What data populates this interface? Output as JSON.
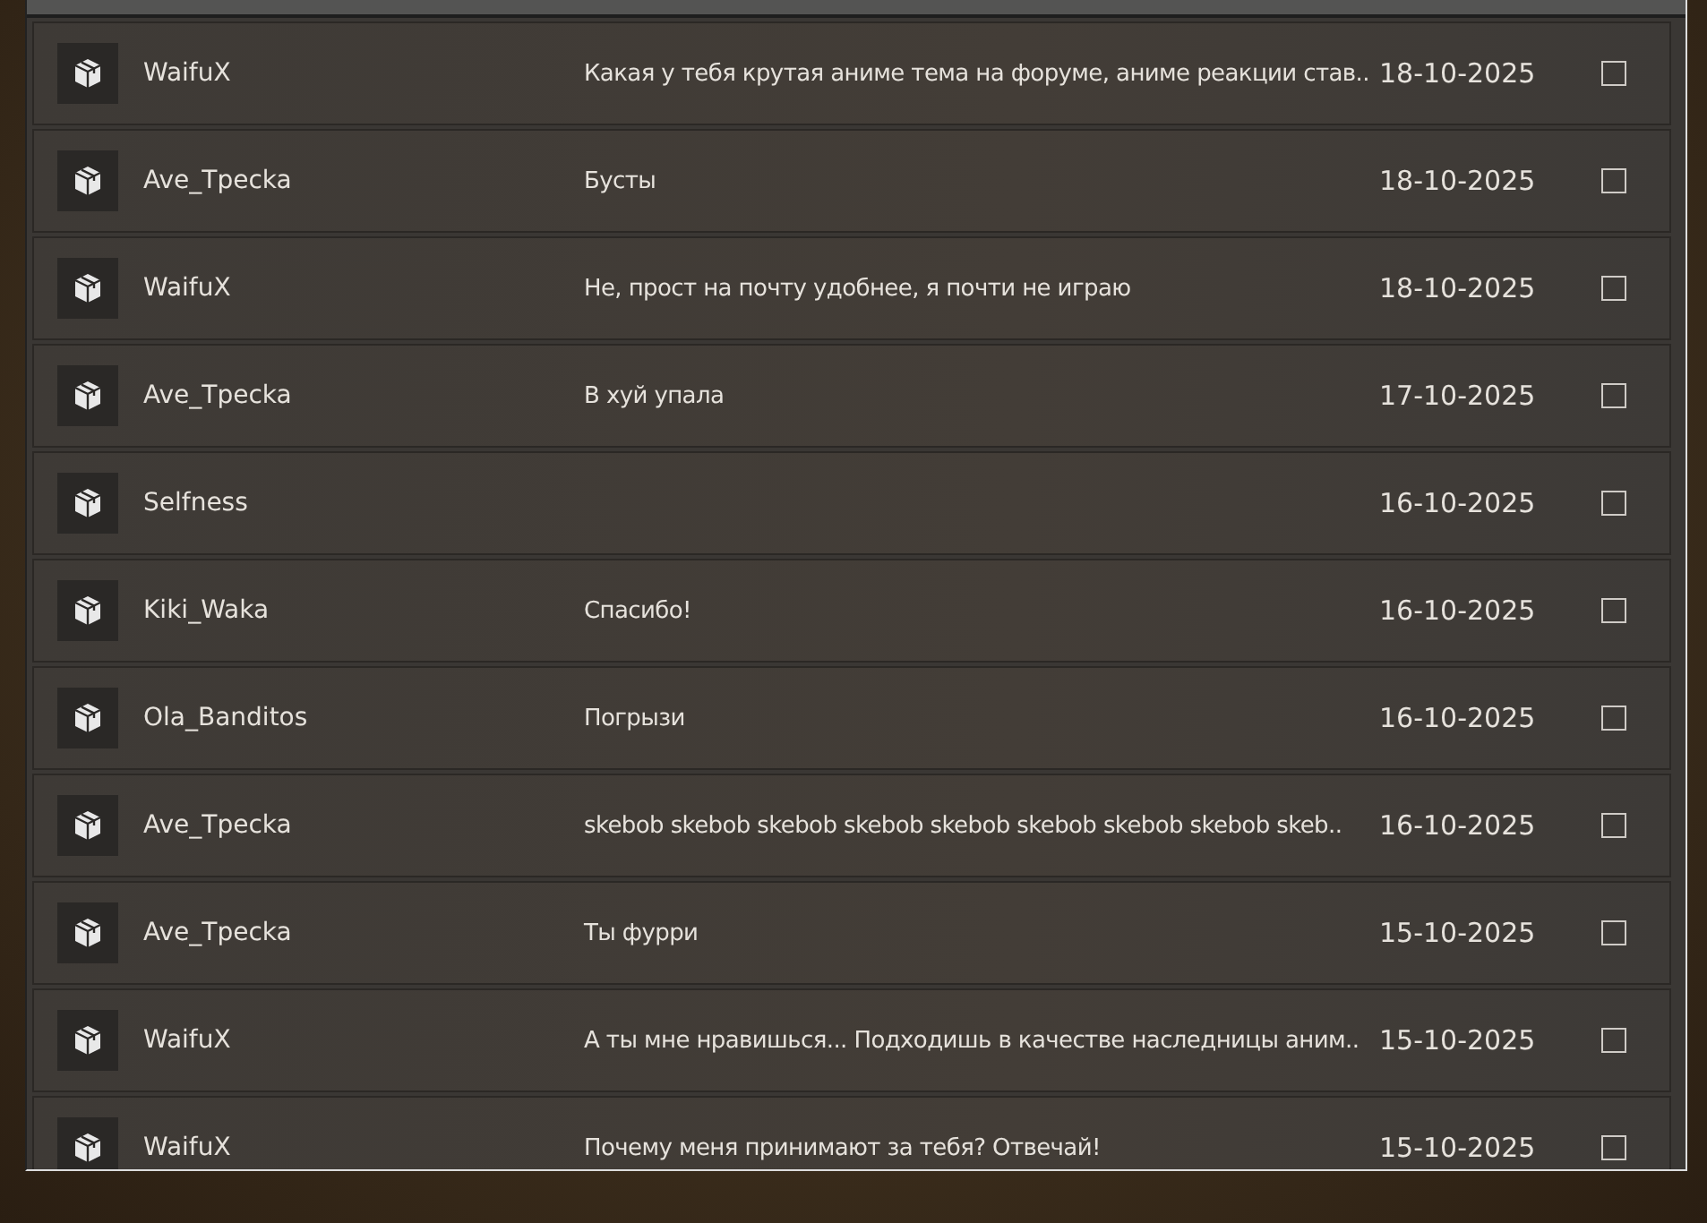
{
  "messages": [
    {
      "sender": "WaifuX",
      "message": "Какая у тебя крутая аниме тема на форуме, аниме реакции став..",
      "date": "18-10-2025",
      "checked": false
    },
    {
      "sender": "Ave_Трecka",
      "message": "Бусты",
      "date": "18-10-2025",
      "checked": false
    },
    {
      "sender": "WaifuX",
      "message": "Не, прост на почту удобнее, я почти не играю",
      "date": "18-10-2025",
      "checked": false
    },
    {
      "sender": "Ave_Трecka",
      "message": "В хуй упала",
      "date": "17-10-2025",
      "checked": false
    },
    {
      "sender": "Selfness",
      "date": "16-10-2025",
      "checked": false
    },
    {
      "sender": "Kiki_Waka",
      "message": "Спасибо!",
      "date": "16-10-2025",
      "checked": false
    },
    {
      "sender": "Ola_Banditos",
      "message": "Погрызи",
      "date": "16-10-2025",
      "checked": false
    },
    {
      "sender": "Ave_Трecka",
      "message": "skebob skebob skebob skebob skebob skebob skebob skebob skeb..",
      "date": "16-10-2025",
      "checked": false
    },
    {
      "sender": "Ave_Трecka",
      "message": "Ты фурри",
      "date": "15-10-2025",
      "checked": false
    },
    {
      "sender": "WaifuX",
      "message": "А ты мне нравишься... Подходишь в качестве наследницы аним..",
      "date": "15-10-2025",
      "checked": false
    },
    {
      "sender": "WaifuX",
      "message": "Почему меня принимают за тебя? Отвечай!",
      "date": "15-10-2025",
      "checked": false
    }
  ]
}
